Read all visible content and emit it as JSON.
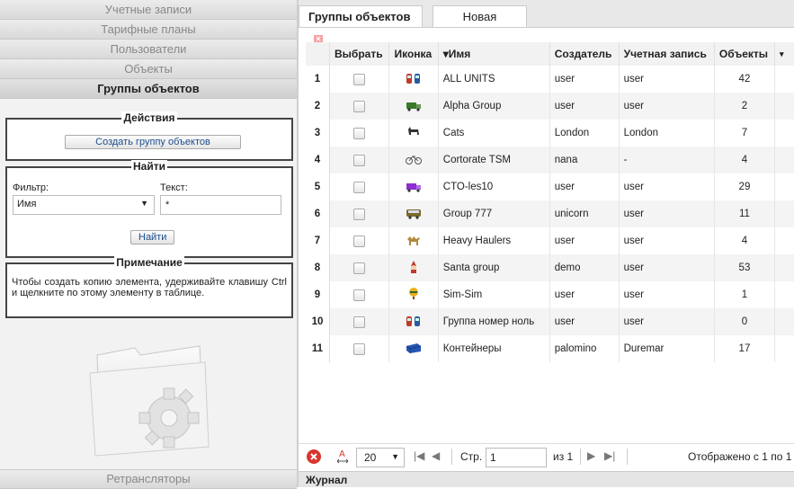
{
  "sidebar": {
    "sections": [
      "Учетные записи",
      "Тарифные планы",
      "Пользователи",
      "Объекты",
      "Группы объектов"
    ],
    "bottom_section": "Ретрансляторы",
    "actions": {
      "title": "Действия",
      "create_button": "Создать группу объектов"
    },
    "search": {
      "title": "Найти",
      "filter_label": "Фильтр:",
      "filter_value": "Имя",
      "text_label": "Текст:",
      "text_value": "*",
      "find_button": "Найти"
    },
    "note": {
      "title": "Примечание",
      "text": "Чтобы создать копию элемента, удерживайте клавишу Ctrl и щелкните по этому элементу в таблице."
    }
  },
  "tabs": [
    {
      "label": "Группы объектов"
    },
    {
      "label": "Новая"
    }
  ],
  "table": {
    "columns": [
      "",
      "Выбрать",
      "Иконка",
      "▾Имя",
      "Создатель",
      "Учетная запись",
      "Объекты",
      "▾"
    ],
    "rows": [
      {
        "num": "1",
        "icon": "multi-unit-icon",
        "name": "ALL UNITS",
        "creator": "user",
        "account": "user",
        "objects": "42"
      },
      {
        "num": "2",
        "icon": "truck-icon",
        "name": "Alpha Group",
        "creator": "user",
        "account": "user",
        "objects": "2"
      },
      {
        "num": "3",
        "icon": "cat-icon",
        "name": "Cats",
        "creator": "London",
        "account": "London",
        "objects": "7"
      },
      {
        "num": "4",
        "icon": "bicycle-icon",
        "name": "Cortorate TSM",
        "creator": "nana",
        "account": "-",
        "objects": "4"
      },
      {
        "num": "5",
        "icon": "purple-truck-icon",
        "name": "CTO-les10",
        "creator": "user",
        "account": "user",
        "objects": "29"
      },
      {
        "num": "6",
        "icon": "bus-icon",
        "name": "Group 777",
        "creator": "unicorn",
        "account": "user",
        "objects": "11"
      },
      {
        "num": "7",
        "icon": "camel-icon",
        "name": "Heavy Haulers",
        "creator": "user",
        "account": "user",
        "objects": "4"
      },
      {
        "num": "8",
        "icon": "santa-icon",
        "name": "Santa group",
        "creator": "demo",
        "account": "user",
        "objects": "53"
      },
      {
        "num": "9",
        "icon": "balloon-icon",
        "name": "Sim-Sim",
        "creator": "user",
        "account": "user",
        "objects": "1"
      },
      {
        "num": "10",
        "icon": "multi-unit-icon",
        "name": "Группа номер ноль",
        "creator": "user",
        "account": "user",
        "objects": "0"
      },
      {
        "num": "11",
        "icon": "container-icon",
        "name": "Контейнеры",
        "creator": "palomino",
        "account": "Duremar",
        "objects": "17"
      }
    ]
  },
  "pager": {
    "page_size": "20",
    "page_label": "Стр.",
    "page_value": "1",
    "of_label": "из 1",
    "display_text": "Отображено с 1 по 1"
  },
  "journal": {
    "label": "Журнал"
  },
  "colors": {
    "delete_icon": "#d9352f",
    "link_blue": "#1a4d8c"
  }
}
